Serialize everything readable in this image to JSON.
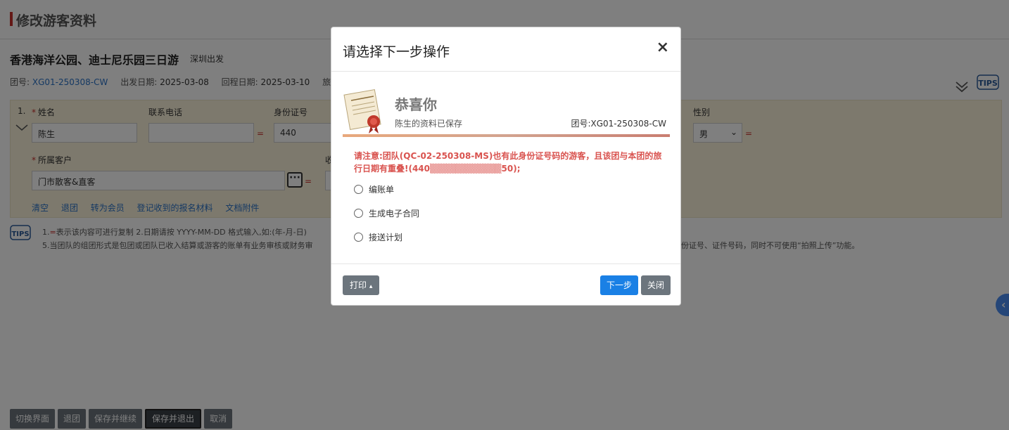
{
  "page": {
    "title": "修改游客资料",
    "tour_title": "香港海洋公园、迪士尼乐园三日游",
    "tour_origin": "深圳出发",
    "info": {
      "group_no_label": "团号:",
      "group_no": "XG01-250308-CW",
      "depart_label": "出发日期:",
      "depart_date": "2025-03-08",
      "return_label": "回程日期:",
      "return_date": "2025-03-10",
      "travel_label": "旅游"
    }
  },
  "form": {
    "row_number": "1.",
    "name_label": "姓名",
    "name_value": "陈生",
    "phone_label": "联系电话",
    "phone_value": "",
    "id_label": "身份证号",
    "id_value": "440",
    "gender_label": "性别",
    "gender_value": "男",
    "customer_label": "所属客户",
    "customer_value": "门市散客&直客",
    "partial_label": "收",
    "required_mark": "*",
    "equal_mark": "=",
    "more_label": "···",
    "links": [
      "清空",
      "退团",
      "转为会员",
      "登记收到的报名材料",
      "文档附件"
    ]
  },
  "notes": {
    "line1_prefix": "1.",
    "line1_eq": "=",
    "line1_text": "表示该内容可进行复制    2.日期请按 YYYY-MM-DD 格式输入,如:(年-月-日)",
    "line2_text": "5.当团队的组团形式是包团或团队已收入结算或游客的账单有业务审核或财务审",
    "line2_tail": "份证号、证件号码，同时不可使用“拍照上传”功能。"
  },
  "bottom_buttons": [
    "切换界面",
    "退团",
    "保存并继续",
    "保存并退出",
    "取消"
  ],
  "side_tab": "‹",
  "modal": {
    "title": "请选择下一步操作",
    "close": "×",
    "congrats": "恭喜你",
    "saved_msg": "陈生的资料已保存",
    "tour_no_label": "团号:",
    "tour_no": "XG01-250308-CW",
    "warning": "请注意:团队(QC-02-250308-MS)也有此身份证号码的游客，且该团与本团的旅行日期有重叠!(440▒▒▒▒▒▒▒▒▒▒▒50);",
    "options": [
      "编账单",
      "生成电子合同",
      "接送计划"
    ],
    "print_label": "打印",
    "print_caret": "▴",
    "next_label": "下一步",
    "close_label": "关闭"
  },
  "icons": {
    "tips": "tips-icon",
    "chevrons": "double-chevron-down-icon",
    "certificate": "certificate-scroll-icon"
  },
  "colors": {
    "accent_red": "#c9302c",
    "link_blue": "#2a72c7",
    "primary_blue": "#1a80e5",
    "secondary_gray": "#6c757d",
    "panel_yellow": "#fbf3db",
    "warning_red": "#d9534f"
  }
}
